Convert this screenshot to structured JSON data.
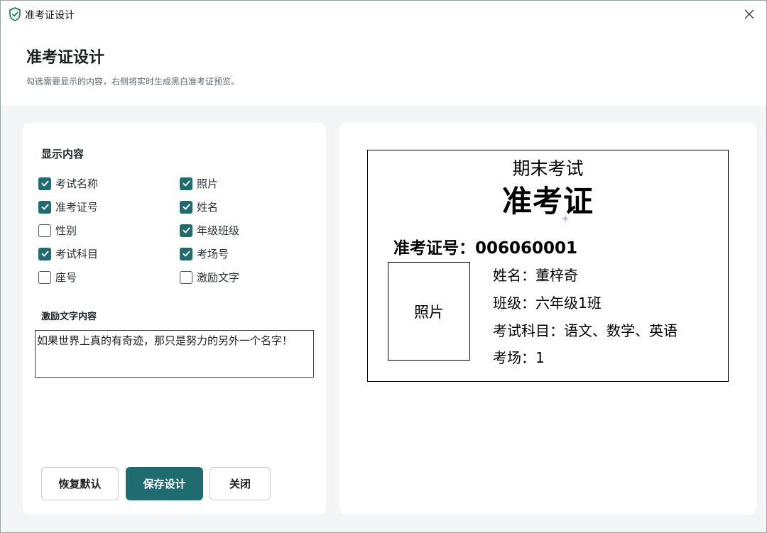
{
  "window": {
    "title": "准考证设计",
    "app_icon": "shield-check-icon",
    "close_icon": "close-icon"
  },
  "header": {
    "title": "准考证设计",
    "subtitle": "勾选需要显示的内容，右侧将实时生成黑白准考证预览。"
  },
  "options": {
    "section_title": "显示内容",
    "items": [
      {
        "label": "考试名称",
        "checked": true
      },
      {
        "label": "照片",
        "checked": true
      },
      {
        "label": "准考证号",
        "checked": true
      },
      {
        "label": "姓名",
        "checked": true
      },
      {
        "label": "性别",
        "checked": false
      },
      {
        "label": "年级班级",
        "checked": true
      },
      {
        "label": "考试科目",
        "checked": true
      },
      {
        "label": "考场号",
        "checked": true
      },
      {
        "label": "座号",
        "checked": false
      },
      {
        "label": "激励文字",
        "checked": false
      }
    ]
  },
  "motto": {
    "label": "激励文字内容",
    "value": "如果世界上真的有奇迹，那只是努力的另外一个名字！"
  },
  "buttons": {
    "reset": "恢复默认",
    "save": "保存设计",
    "close": "关闭"
  },
  "colors": {
    "accent": "#1f6b70",
    "panel_bg": "#f3f5f7"
  },
  "ticket": {
    "exam_name": "期末考试",
    "title": "准考证",
    "number": "准考证号：006060001",
    "photo_label": "照片",
    "name": "姓名：董梓奇",
    "class": "班级：六年级1班",
    "subjects": "考试科目：语文、数学、英语",
    "room": "考场：1"
  }
}
